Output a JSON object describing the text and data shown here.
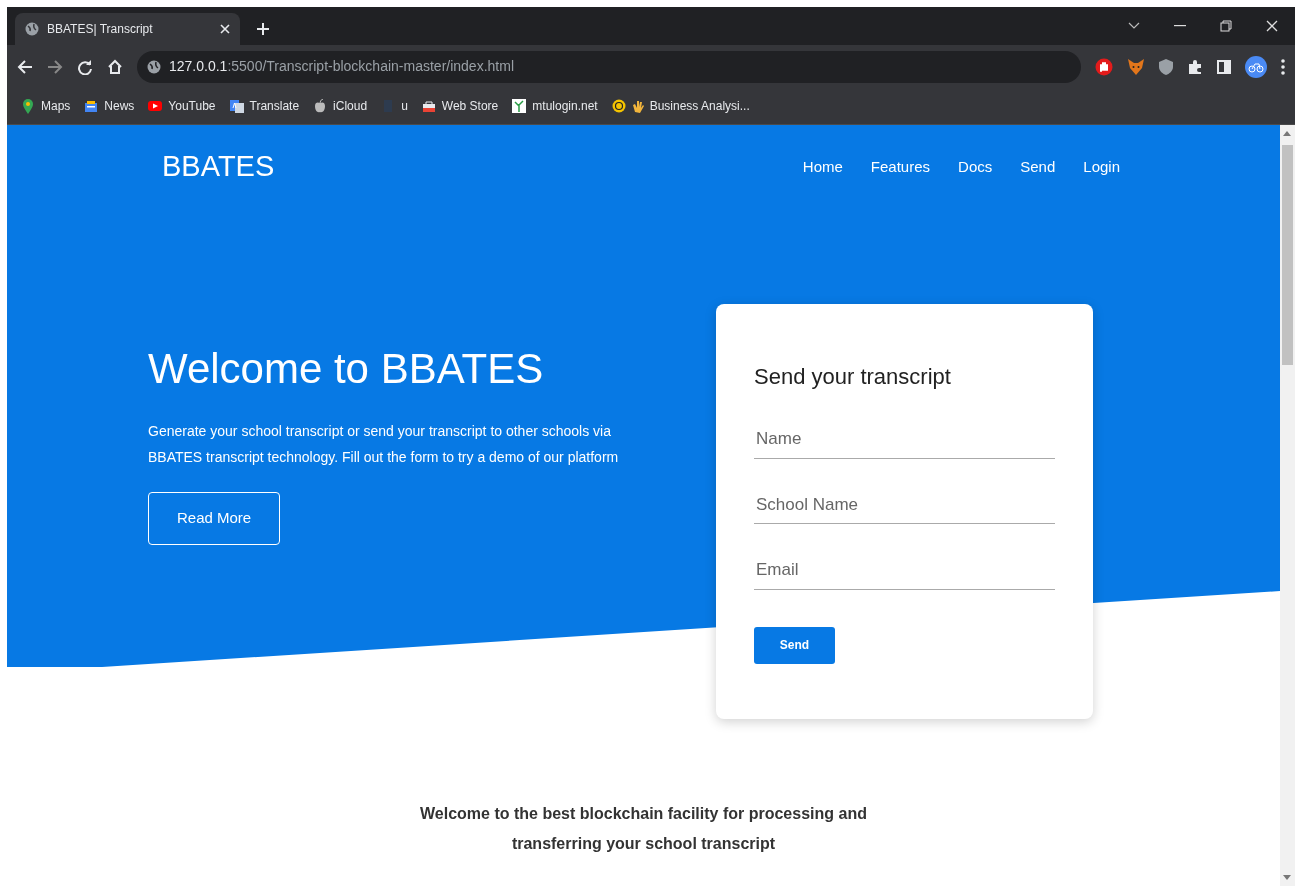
{
  "browser": {
    "tab": {
      "title": "BBATES| Transcript",
      "selected": true
    },
    "address": {
      "host": "127.0.0.1",
      "path": ":5500/Transcript-blockchain-master/index.html"
    },
    "bookmarks": [
      {
        "label": "Maps"
      },
      {
        "label": "News"
      },
      {
        "label": "YouTube"
      },
      {
        "label": "Translate"
      },
      {
        "label": "iCloud"
      },
      {
        "label": "u"
      },
      {
        "label": "Web Store"
      },
      {
        "label": "mtulogin.net"
      },
      {
        "label": "Business Analysi..."
      }
    ]
  },
  "page": {
    "brand": "BBATES",
    "nav": [
      {
        "label": "Home"
      },
      {
        "label": "Features"
      },
      {
        "label": "Docs"
      },
      {
        "label": "Send"
      },
      {
        "label": "Login"
      }
    ],
    "hero": {
      "title": "Welcome to BBATES",
      "text": "Generate your school transcript or send your transcript to other schools via BBATES transcript technology. Fill out the form to try a demo of our platform",
      "button": "Read More"
    },
    "form": {
      "title": "Send your transcript",
      "fields": [
        {
          "placeholder": "Name"
        },
        {
          "placeholder": "School Name"
        },
        {
          "placeholder": "Email"
        }
      ],
      "button": "Send"
    },
    "intro": "Welcome to the best blockchain facility for processing and transferring your school transcript"
  }
}
